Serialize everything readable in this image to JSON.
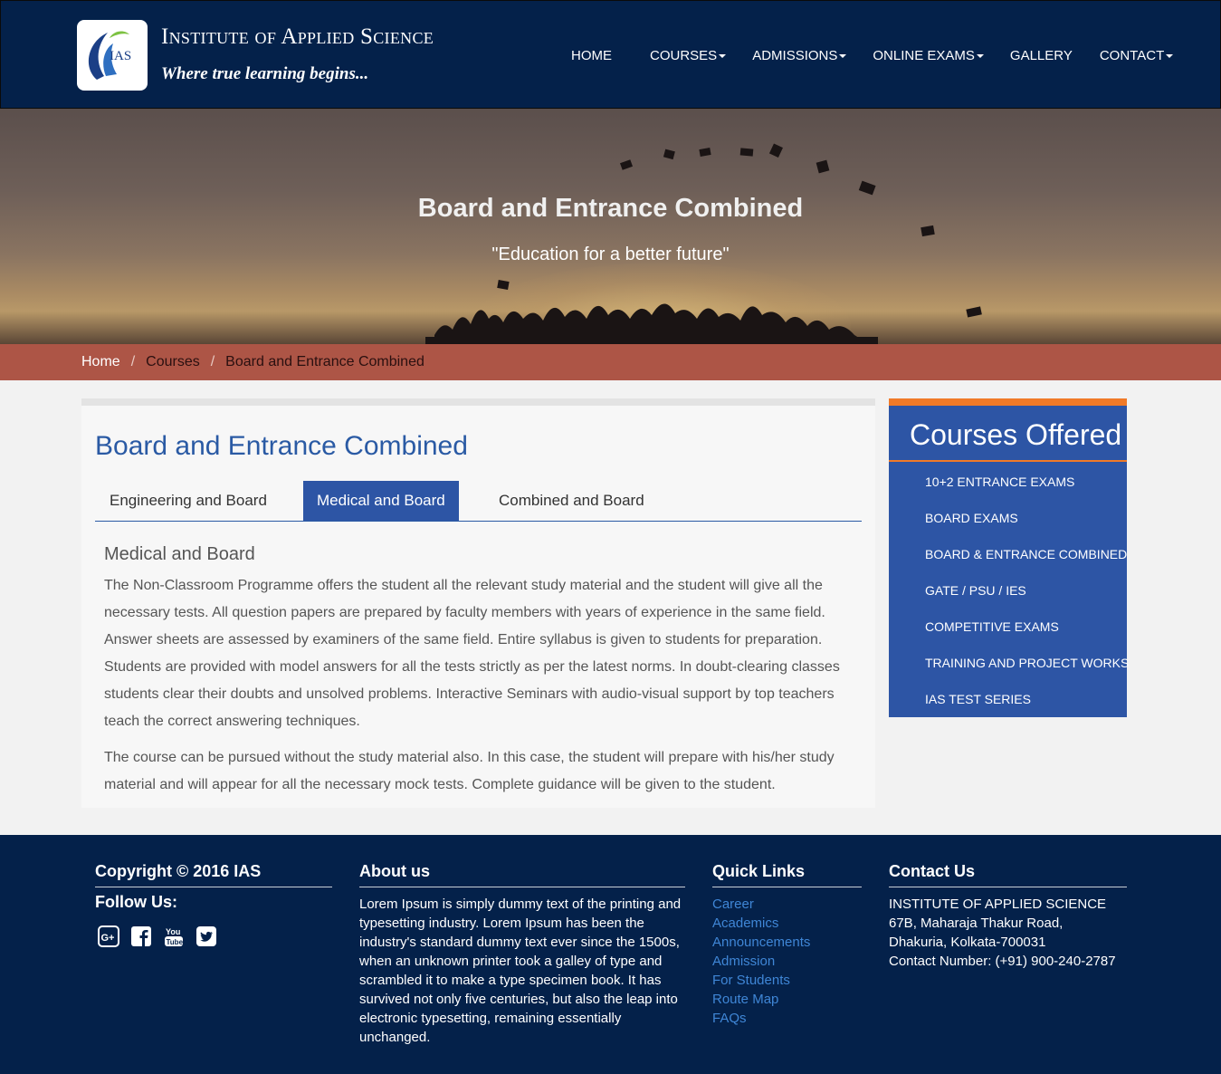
{
  "brand": {
    "logo_text": "IAS",
    "title": "Institute of Applied Science",
    "tagline": "Where true learning begins..."
  },
  "nav": {
    "items": [
      {
        "label": "HOME",
        "dropdown": false
      },
      {
        "label": "COURSES",
        "dropdown": true
      },
      {
        "label": "ADMISSIONS",
        "dropdown": true
      },
      {
        "label": "ONLINE EXAMS",
        "dropdown": true
      },
      {
        "label": "GALLERY",
        "dropdown": false
      },
      {
        "label": "CONTACT",
        "dropdown": true
      }
    ]
  },
  "hero": {
    "title": "Board and Entrance Combined",
    "subtitle": "\"Education for a better future\""
  },
  "breadcrumb": {
    "home": "Home",
    "sep": "/",
    "courses": "Courses",
    "current": "Board and Entrance Combined"
  },
  "main": {
    "title": "Board and Entrance Combined",
    "tabs": [
      {
        "label": "Engineering and Board",
        "active": false
      },
      {
        "label": "Medical and Board",
        "active": true
      },
      {
        "label": "Combined and Board",
        "active": false
      }
    ],
    "section_heading": "Medical and Board",
    "paragraphs": [
      "The Non-Classroom Programme offers the student all the relevant study material and the student will give all the necessary tests. All question papers are prepared by faculty members with years of experience in the same field. Answer sheets are assessed by examiners of the same field. Entire syllabus is given to students for preparation. Students are provided with model answers for all the tests strictly as per the latest norms. In doubt-clearing classes students clear their doubts and unsolved problems. Interactive Seminars with audio-visual support by top teachers teach the correct answering techniques.",
      "The course can be pursued without the study material also. In this case, the student will prepare with his/her study material and will appear for all the necessary mock tests. Complete guidance will be given to the student."
    ]
  },
  "sidebar": {
    "title": "Courses Offered",
    "items": [
      "10+2 ENTRANCE EXAMS",
      "BOARD EXAMS",
      "BOARD & ENTRANCE COMBINED",
      "GATE / PSU / IES",
      "COMPETITIVE EXAMS",
      "TRAINING AND PROJECT WORKS",
      "IAS TEST SERIES"
    ]
  },
  "footer": {
    "copyright": "Copyright © 2016 IAS",
    "follow_us": "Follow Us:",
    "social_icons": [
      "google-plus-icon",
      "facebook-icon",
      "youtube-icon",
      "twitter-icon"
    ],
    "about_heading": "About us",
    "about_text": "Lorem Ipsum is simply dummy text of the printing and typesetting industry. Lorem Ipsum has been the industry's standard dummy text ever since the 1500s, when an unknown printer took a galley of type and scrambled it to make a type specimen book. It has survived not only five centuries, but also the leap into electronic typesetting, remaining essentially unchanged.",
    "quick_links_heading": "Quick Links",
    "quick_links": [
      "Career",
      "Academics",
      "Announcements",
      "Admission",
      "For Students",
      "Route Map",
      "FAQs"
    ],
    "contact_heading": "Contact Us",
    "contact_lines": [
      "INSTITUTE OF APPLIED SCIENCE",
      "67B, Maharaja Thakur Road,",
      "Dhakuria, Kolkata-700031",
      "Contact Number: (+91) 900-240-2787"
    ]
  },
  "colors": {
    "navbar_bg": "#04214a",
    "breadcrumb_bg": "#ad5546",
    "accent_blue": "#2d55a5",
    "accent_orange": "#f07a28",
    "link_blue": "#3f86d6"
  }
}
